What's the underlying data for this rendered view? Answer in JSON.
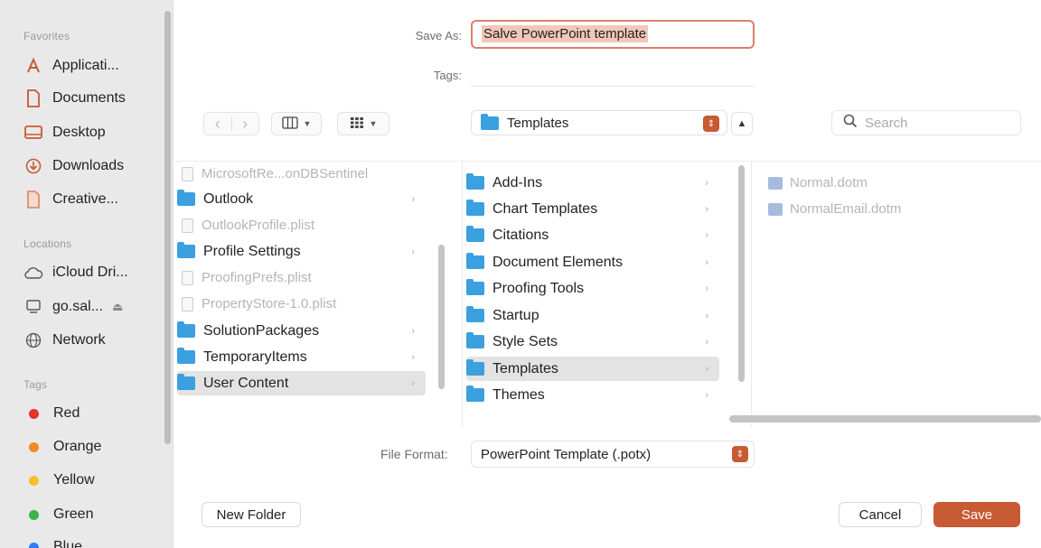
{
  "sidebar": {
    "favorites_heading": "Favorites",
    "favorites": [
      {
        "label": "Applicati...",
        "icon": "applications-icon"
      },
      {
        "label": "Documents",
        "icon": "document-icon"
      },
      {
        "label": "Desktop",
        "icon": "desktop-icon"
      },
      {
        "label": "Downloads",
        "icon": "downloads-icon"
      },
      {
        "label": "Creative...",
        "icon": "document-icon"
      }
    ],
    "locations_heading": "Locations",
    "locations": [
      {
        "label": "iCloud Dri...",
        "icon": "cloud-icon"
      },
      {
        "label": "go.sal...",
        "icon": "computer-icon",
        "eject": "⏏"
      },
      {
        "label": "Network",
        "icon": "globe-icon"
      }
    ],
    "tags_heading": "Tags",
    "tags": [
      {
        "label": "Red",
        "color": "#e5322d"
      },
      {
        "label": "Orange",
        "color": "#f08a24"
      },
      {
        "label": "Yellow",
        "color": "#f6c02c"
      },
      {
        "label": "Green",
        "color": "#39b54a"
      },
      {
        "label": "Blue",
        "color": "#2f7cf6"
      }
    ]
  },
  "form": {
    "save_as_label": "Save As:",
    "save_as_value": "Salve PowerPoint template",
    "tags_label": "Tags:",
    "tags_value": ""
  },
  "toolbar": {
    "back": "‹",
    "forward": "›",
    "path": "Templates",
    "search_placeholder": "Search"
  },
  "browser": {
    "column1": [
      {
        "label": "MicrosoftRe...onDBSentinel",
        "type": "file",
        "dim": true
      },
      {
        "label": "Outlook",
        "type": "folder",
        "arrow": true
      },
      {
        "label": "OutlookProfile.plist",
        "type": "file",
        "dim": true
      },
      {
        "label": "Profile Settings",
        "type": "folder",
        "arrow": true
      },
      {
        "label": "ProofingPrefs.plist",
        "type": "file",
        "dim": true
      },
      {
        "label": "PropertyStore-1.0.plist",
        "type": "file",
        "dim": true
      },
      {
        "label": "SolutionPackages",
        "type": "folder",
        "arrow": true
      },
      {
        "label": "TemporaryItems",
        "type": "folder",
        "arrow": true
      },
      {
        "label": "User Content",
        "type": "folder",
        "arrow": true,
        "selected": true
      }
    ],
    "column2": [
      {
        "label": "Add-Ins"
      },
      {
        "label": "Chart Templates"
      },
      {
        "label": "Citations"
      },
      {
        "label": "Document Elements"
      },
      {
        "label": "Proofing Tools"
      },
      {
        "label": "Startup"
      },
      {
        "label": "Style Sets"
      },
      {
        "label": "Templates",
        "selected": true
      },
      {
        "label": "Themes"
      }
    ],
    "column3": [
      {
        "label": "Normal.dotm"
      },
      {
        "label": "NormalEmail.dotm"
      }
    ]
  },
  "format": {
    "label": "File Format:",
    "value": "PowerPoint Template (.potx)"
  },
  "buttons": {
    "new_folder": "New Folder",
    "cancel": "Cancel",
    "save": "Save"
  },
  "colors": {
    "accent": "#c85a34",
    "folder": "#3ba0e0"
  }
}
